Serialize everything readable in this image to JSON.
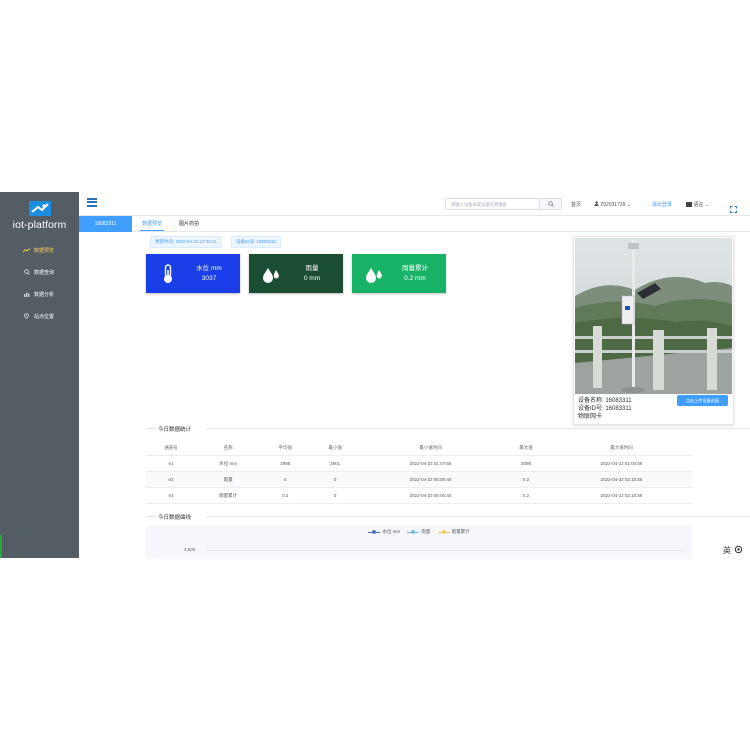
{
  "app": {
    "brand": "iot-platform"
  },
  "sidebar": {
    "items": [
      {
        "label": "数据预览",
        "icon": "trend-icon",
        "active": true
      },
      {
        "label": "数据查询",
        "icon": "search-icon",
        "active": false
      },
      {
        "label": "数据分析",
        "icon": "bar-chart-icon",
        "active": false
      },
      {
        "label": "站点位置",
        "icon": "location-icon",
        "active": false
      }
    ]
  },
  "header": {
    "search_placeholder": "请输入设备ID或设备名称搜索",
    "home_label": "首页",
    "user_label": "292031739",
    "logout_label": "退出登录",
    "language_label": "语言"
  },
  "tabs": {
    "device_tab": "16083311",
    "items": [
      {
        "label": "数据预览",
        "active": true
      },
      {
        "label": "图片抓拍",
        "active": false
      }
    ]
  },
  "tags": {
    "update_time": "更新时间: 2022-04-22 17:32:11",
    "device_id": "设备ID号: 16083311"
  },
  "cards": [
    {
      "label": "水位 mm",
      "value": "3037",
      "color": "#1a3fe8",
      "icon": "thermometer-icon"
    },
    {
      "label": "雨量",
      "value": "0 mm",
      "color": "#1b4d33",
      "icon": "water-drops-icon"
    },
    {
      "label": "雨量累计",
      "value": "0.2 mm",
      "color": "#19b368",
      "icon": "water-drops-icon"
    }
  ],
  "device": {
    "name_line": "设备名称: 16083311",
    "id_line": "设备ID号: 16083311",
    "sim_line": "物联网卡",
    "upload_button": "点击上传设备封面"
  },
  "stats": {
    "title": "今日数据统计",
    "columns": [
      "通道号",
      "名称",
      "平均值",
      "最小值",
      "最小值时间",
      "最大值",
      "最大值时间"
    ],
    "rows": [
      [
        "e1",
        "水位 mm",
        "2995",
        "2901",
        "2022-04-22 01:07:56",
        "3098",
        "2022-04-22 01:00:56"
      ],
      [
        "e2",
        "雨量",
        "0",
        "0",
        "2022-04-22 00:00:40",
        "0.2",
        "2022-04-22 02:10:56"
      ],
      [
        "e3",
        "雨量累计",
        "0.2",
        "0",
        "2022-04-22 00:00:40",
        "0.2",
        "2022-04-22 02:10:56"
      ]
    ]
  },
  "curve": {
    "title": "今日数据曲线",
    "legend": [
      {
        "name": "水位 mm",
        "color": "#5470c6"
      },
      {
        "name": "雨量",
        "color": "#73c0de"
      },
      {
        "name": "雨量累计",
        "color": "#fac858"
      }
    ],
    "y_tick": "3,500"
  },
  "floating": {
    "lang_char": "英"
  }
}
